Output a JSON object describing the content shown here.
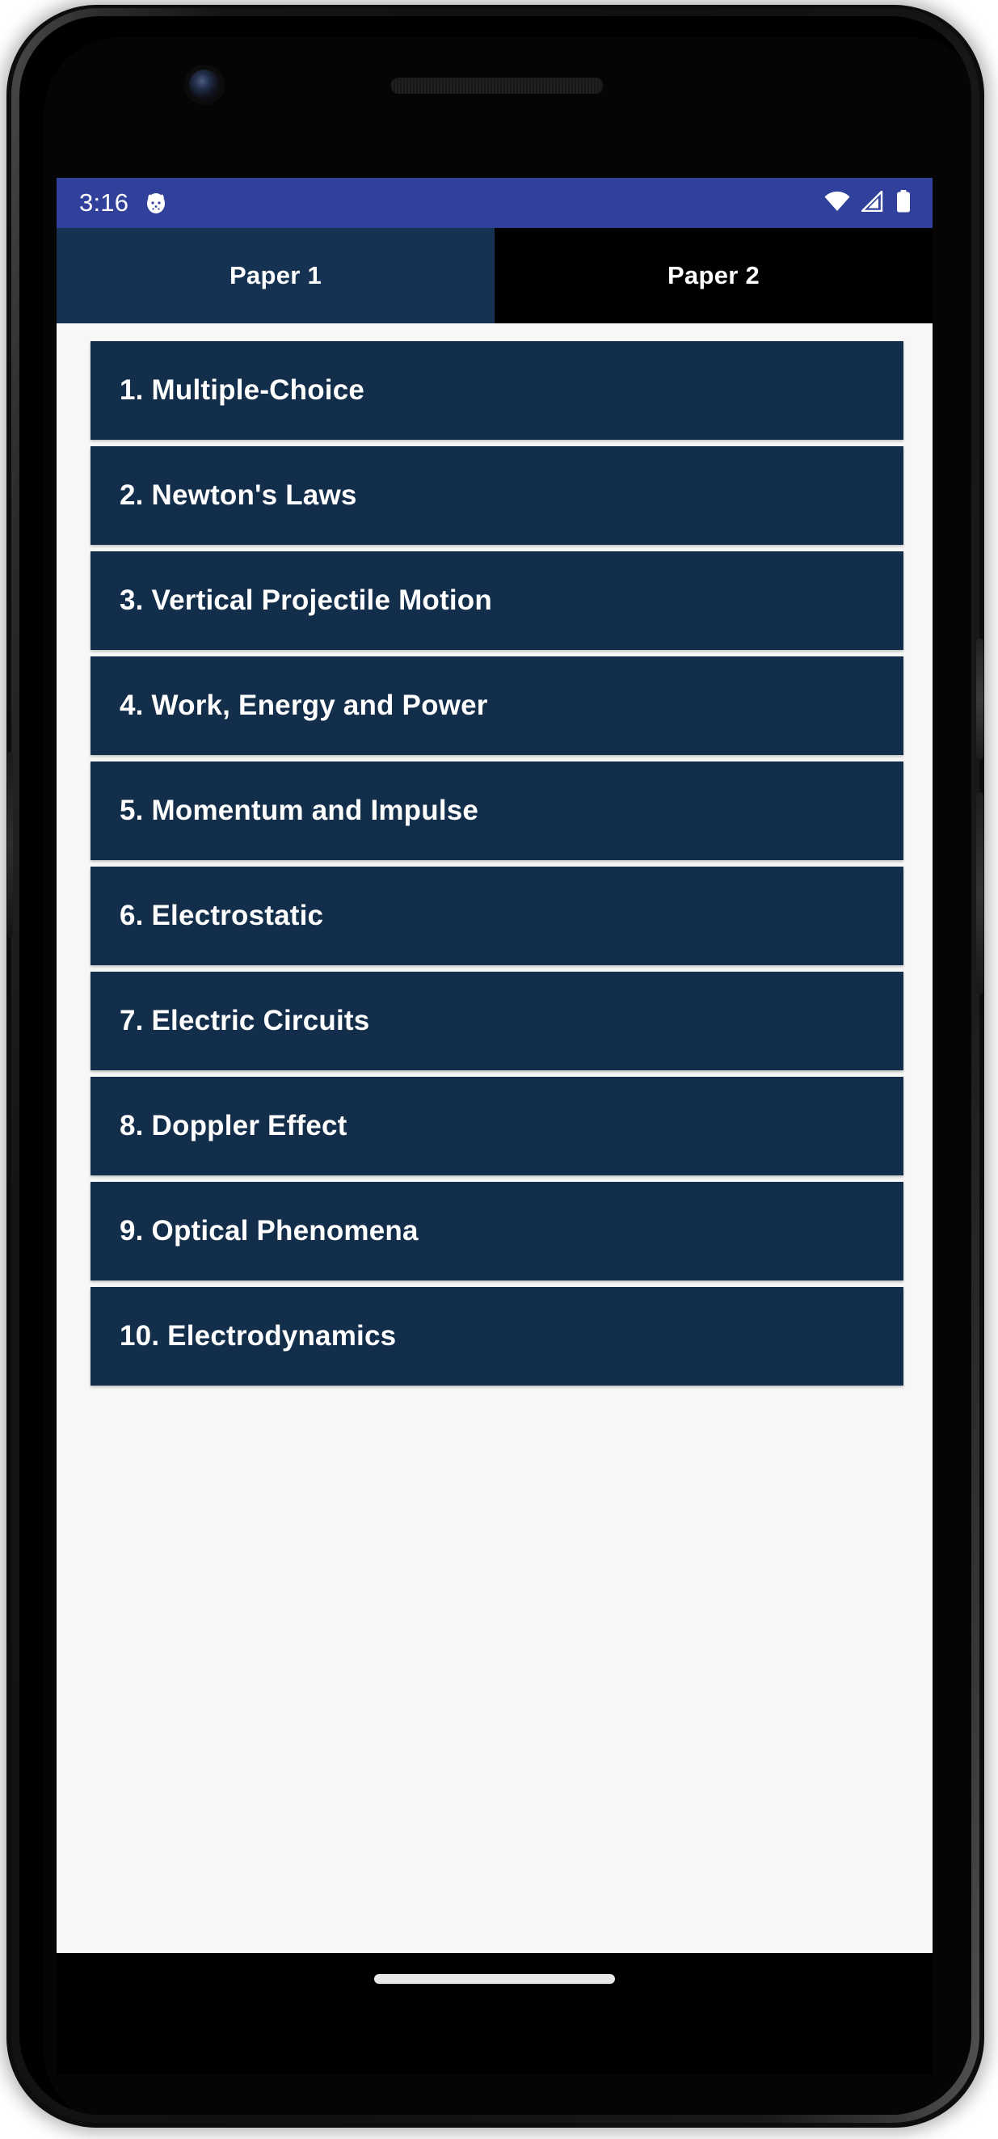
{
  "status_bar": {
    "time": "3:16",
    "app_icon": "notification-app-icon",
    "icons": [
      "wifi-icon",
      "cellular-signal-icon",
      "battery-icon"
    ],
    "background_color": "#30409B"
  },
  "tabs": {
    "items": [
      {
        "label": "Paper 1",
        "active": true
      },
      {
        "label": "Paper 2",
        "active": false
      }
    ],
    "active_color": "#153252",
    "inactive_color": "#000000"
  },
  "content": {
    "background_color": "#F7F7F7",
    "item_color": "#132E4A",
    "items": [
      {
        "label": "1. Multiple-Choice"
      },
      {
        "label": "2. Newton's Laws"
      },
      {
        "label": "3. Vertical Projectile Motion"
      },
      {
        "label": "4. Work, Energy and Power"
      },
      {
        "label": "5. Momentum and Impulse"
      },
      {
        "label": "6. Electrostatic"
      },
      {
        "label": "7. Electric Circuits"
      },
      {
        "label": "8. Doppler Effect"
      },
      {
        "label": "9. Optical Phenomena"
      },
      {
        "label": "10. Electrodynamics"
      }
    ]
  },
  "navigation": {
    "gesture_pill": "home-gesture-pill"
  }
}
